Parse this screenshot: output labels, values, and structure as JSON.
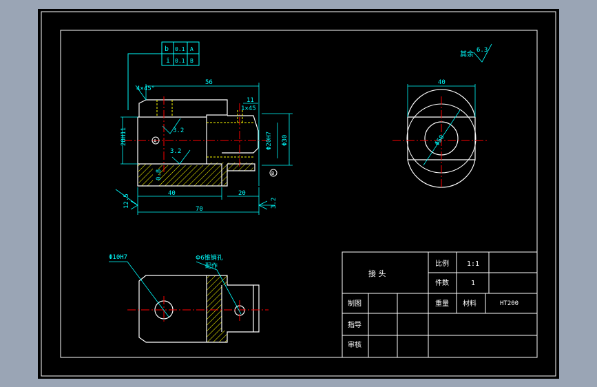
{
  "colors": {
    "background": "#9aa5b5",
    "paper": "#000000",
    "frame": "#ffffff",
    "outline": "#ffffff",
    "dimension": "#00ffff",
    "centerline": "#ff0000",
    "hatch": "#ffff00",
    "hidden": "#ffff00"
  },
  "tolerance_frame": {
    "row1": [
      "b",
      "0.1",
      "A"
    ],
    "row2": [
      "i",
      "0.1",
      "B"
    ]
  },
  "front_view": {
    "chamfer": "4×45°",
    "dim_top": "56",
    "dim_11": "11",
    "chamfer_small": "1×45",
    "dim_height": "28H11",
    "rough_a": "3.2",
    "rough_b": "3.2",
    "rough_c": "0.8",
    "datum_a": "A",
    "datum_b": "B",
    "dim_bore": "Φ20H7",
    "dim_outer": "Φ30",
    "dim_40": "40",
    "dim_20": "20",
    "dim_70": "70",
    "rough_left": "12.5",
    "rough_right": "3.2"
  },
  "side_view": {
    "dim_width": "40",
    "dim_diameter": "Φ50",
    "remaining_label": "其余",
    "remaining_value": "6.3"
  },
  "top_view": {
    "hole_label": "Φ10H7",
    "pin_label_1": "Φ6锥销孔",
    "pin_label_2": "配作"
  },
  "title_block": {
    "part_name": "接  头",
    "scale_label": "比例",
    "scale_value": "1:1",
    "qty_label": "件数",
    "qty_value": "1",
    "drawn_label": "制图",
    "weight_label": "重量",
    "material_label": "材料",
    "material_value": "HT200",
    "guide_label": "指导",
    "review_label": "审核"
  }
}
